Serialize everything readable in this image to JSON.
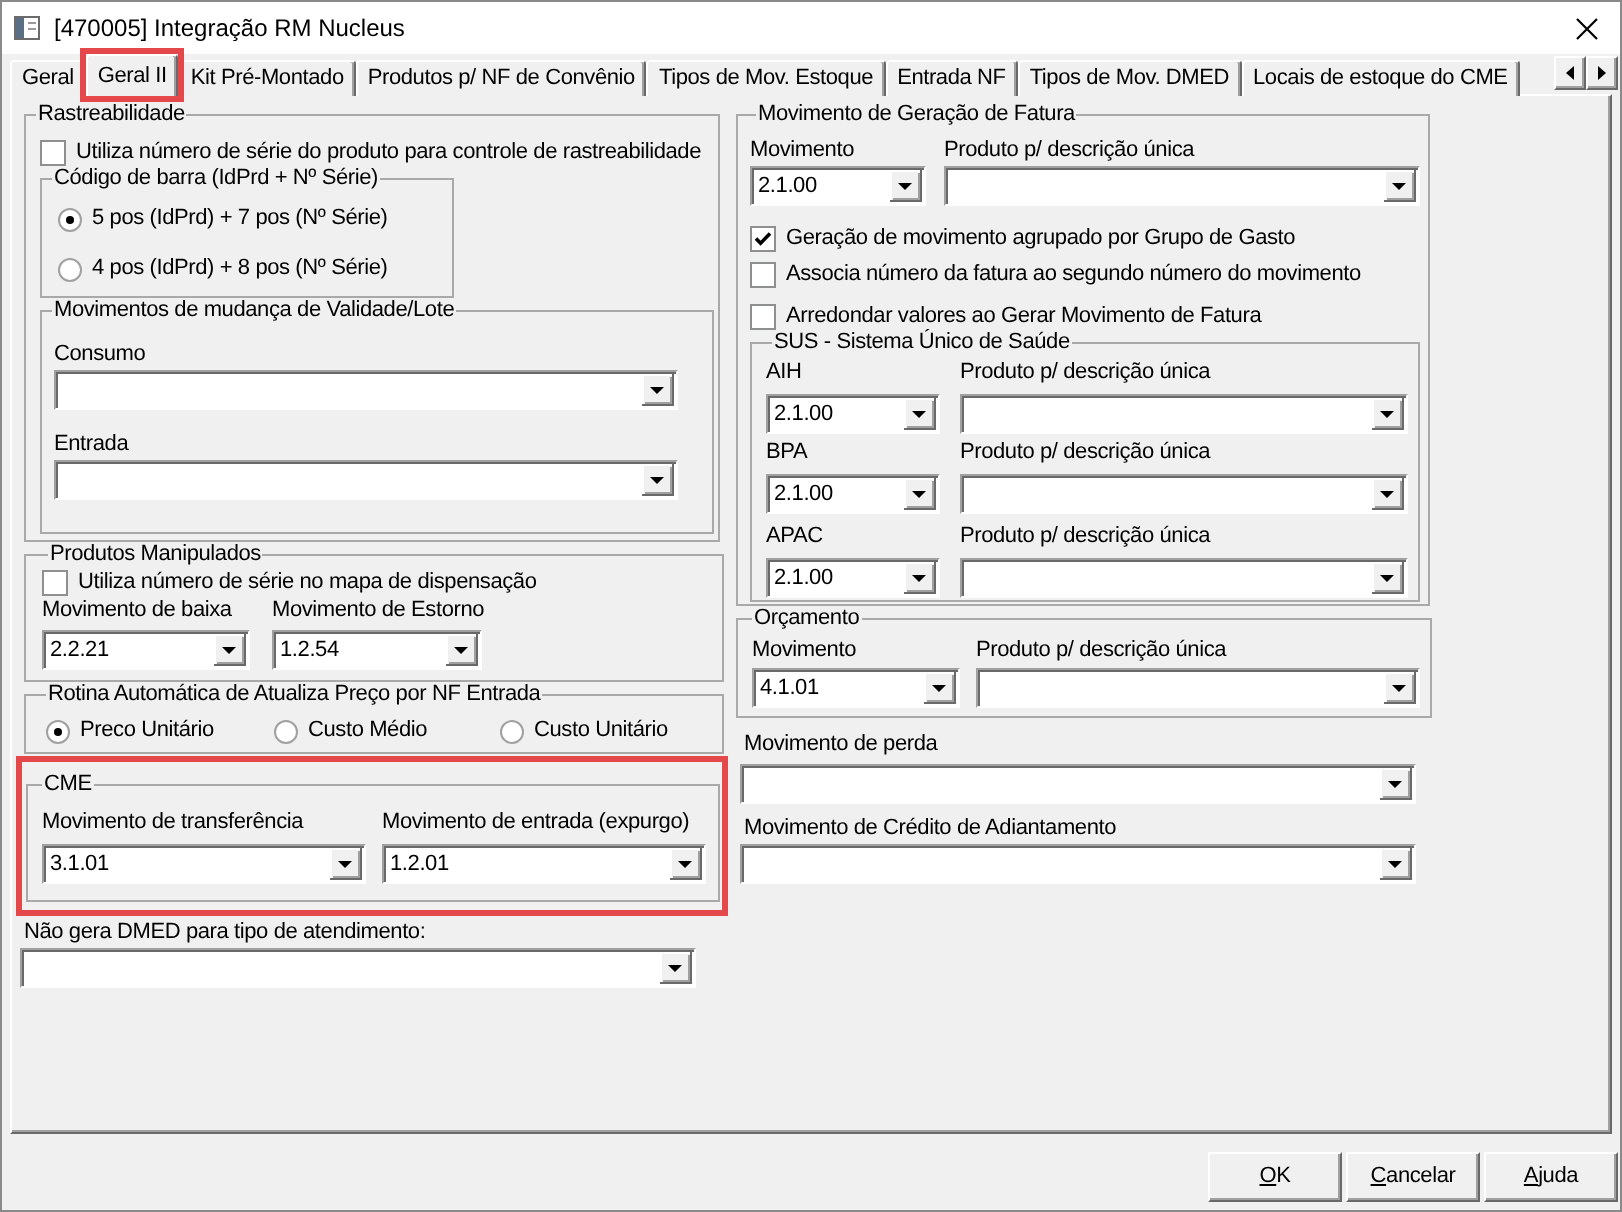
{
  "window": {
    "title": "[470005] Integração RM Nucleus"
  },
  "tabs": [
    {
      "label": "Geral",
      "selected": false,
      "highlighted": false
    },
    {
      "label": "Geral II",
      "selected": true,
      "highlighted": true
    },
    {
      "label": "Kit Pré-Montado",
      "selected": false,
      "highlighted": false
    },
    {
      "label": "Produtos p/ NF de Convênio",
      "selected": false,
      "highlighted": false
    },
    {
      "label": "Tipos de Mov. Estoque",
      "selected": false,
      "highlighted": false
    },
    {
      "label": "Entrada NF",
      "selected": false,
      "highlighted": false
    },
    {
      "label": "Tipos de Mov. DMED",
      "selected": false,
      "highlighted": false
    },
    {
      "label": "Locais de estoque do CME",
      "selected": false,
      "highlighted": false
    }
  ],
  "rastreabilidade": {
    "title": "Rastreabilidade",
    "checkbox": {
      "label": "Utiliza número de série do produto para controle de rastreabilidade",
      "checked": false
    },
    "barcode": {
      "title": "Código de barra (IdPrd + Nº Série)",
      "options": [
        {
          "label": "5 pos (IdPrd) + 7 pos (Nº Série)",
          "selected": true
        },
        {
          "label": "4 pos (IdPrd) + 8 pos (Nº Série)",
          "selected": false
        }
      ]
    },
    "validity": {
      "title": "Movimentos de mudança de Validade/Lote",
      "fields": [
        {
          "label": "Consumo"
        },
        {
          "label": "Entrada"
        }
      ]
    }
  },
  "produtos_manipulados": {
    "title": "Produtos Manipulados",
    "checkbox": {
      "label": "Utiliza número de série no mapa de dispensação",
      "checked": false
    },
    "fields": [
      {
        "label": "Movimento de baixa",
        "value": "2.2.21"
      },
      {
        "label": "Movimento de Estorno",
        "value": "1.2.54"
      }
    ]
  },
  "rotina": {
    "title": "Rotina Automática de Atualiza Preço por NF Entrada",
    "options": [
      {
        "label": "Preco Unitário",
        "selected": true
      },
      {
        "label": "Custo Médio",
        "selected": false
      },
      {
        "label": "Custo Unitário",
        "selected": false
      }
    ]
  },
  "cme": {
    "title": "CME",
    "highlighted": true,
    "fields": [
      {
        "label": "Movimento de transferência",
        "value": "3.1.01"
      },
      {
        "label": "Movimento de entrada (expurgo)",
        "value": "1.2.01"
      }
    ]
  },
  "dmed": {
    "label": "Não gera DMED para tipo de atendimento:"
  },
  "fatura": {
    "title": "Movimento de Geração de Fatura",
    "fields": [
      {
        "label": "Movimento",
        "value": "2.1.00"
      },
      {
        "label": "Produto p/ descrição única"
      }
    ],
    "checkboxes": [
      {
        "label": "Geração de movimento agrupado por Grupo de Gasto",
        "checked": true
      },
      {
        "label": "Associa número da fatura ao segundo número do movimento",
        "checked": false
      },
      {
        "label": "Arredondar valores ao Gerar Movimento de Fatura",
        "checked": false
      }
    ],
    "sus": {
      "title": "SUS - Sistema Único de Saúde",
      "rows": [
        {
          "fields": [
            {
              "label": "AIH",
              "value": "2.1.00"
            },
            {
              "label": "Produto p/ descrição única"
            }
          ]
        },
        {
          "fields": [
            {
              "label": "BPA",
              "value": "2.1.00"
            },
            {
              "label": "Produto p/ descrição única"
            }
          ]
        },
        {
          "fields": [
            {
              "label": "APAC",
              "value": "2.1.00"
            },
            {
              "label": "Produto p/ descrição única"
            }
          ]
        }
      ]
    }
  },
  "orcamento": {
    "title": "Orçamento",
    "fields": [
      {
        "label": "Movimento",
        "value": "4.1.01"
      },
      {
        "label": "Produto p/ descrição única"
      }
    ]
  },
  "perda": {
    "label": "Movimento de perda"
  },
  "credito": {
    "label": "Movimento de Crédito de Adiantamento"
  },
  "buttons": [
    {
      "label": "OK",
      "access_key_underlined": true
    },
    {
      "label": "Cancelar",
      "access_key_underlined": true
    },
    {
      "label": "Ajuda",
      "access_key_underlined": true
    }
  ]
}
